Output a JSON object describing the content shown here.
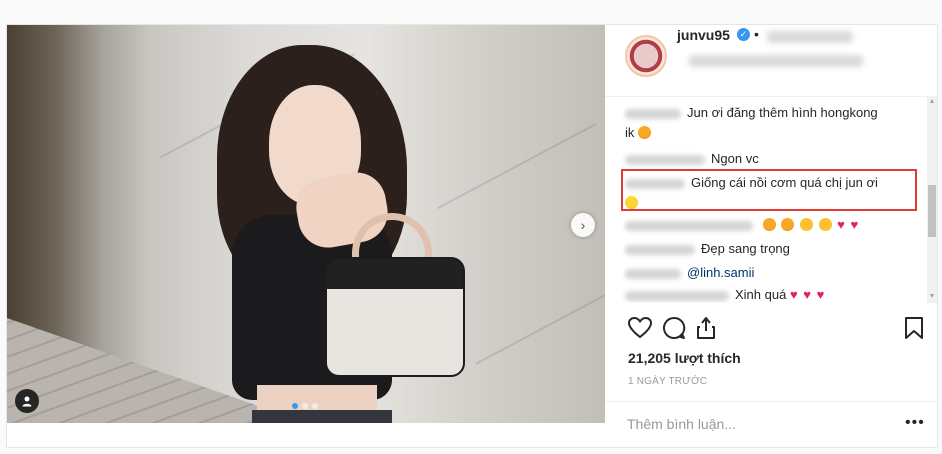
{
  "post": {
    "username": "junvu95",
    "verified_icon": "verified-badge-icon",
    "header_separator": "•",
    "gallery_dots": [
      true,
      false,
      false
    ]
  },
  "comments": [
    {
      "text_line1": "Jun ơi đăng thêm hình hongkong",
      "text_line2": "ik"
    },
    {
      "text": "Ngon vc"
    },
    {
      "text_line1": "Giống cái nồi cơm quá chị jun ơi"
    },
    {
      "emojis": [
        "star-struck",
        "star-struck",
        "kiss",
        "kiss",
        "heart",
        "heart"
      ]
    },
    {
      "text": "Đẹp sang trọng"
    },
    {
      "mention": "@linh.samii"
    },
    {
      "text": "Xinh quá",
      "hearts": 3
    }
  ],
  "stats": {
    "likes": "21,205 lượt thích",
    "time_ago": "1 NGÀY TRƯỚC"
  },
  "add_comment": {
    "placeholder": "Thêm bình luận...",
    "more": "•••"
  },
  "colors": {
    "highlight_border": "#e53935",
    "active_dot": "#3897f0",
    "heart": "#e0245e"
  }
}
